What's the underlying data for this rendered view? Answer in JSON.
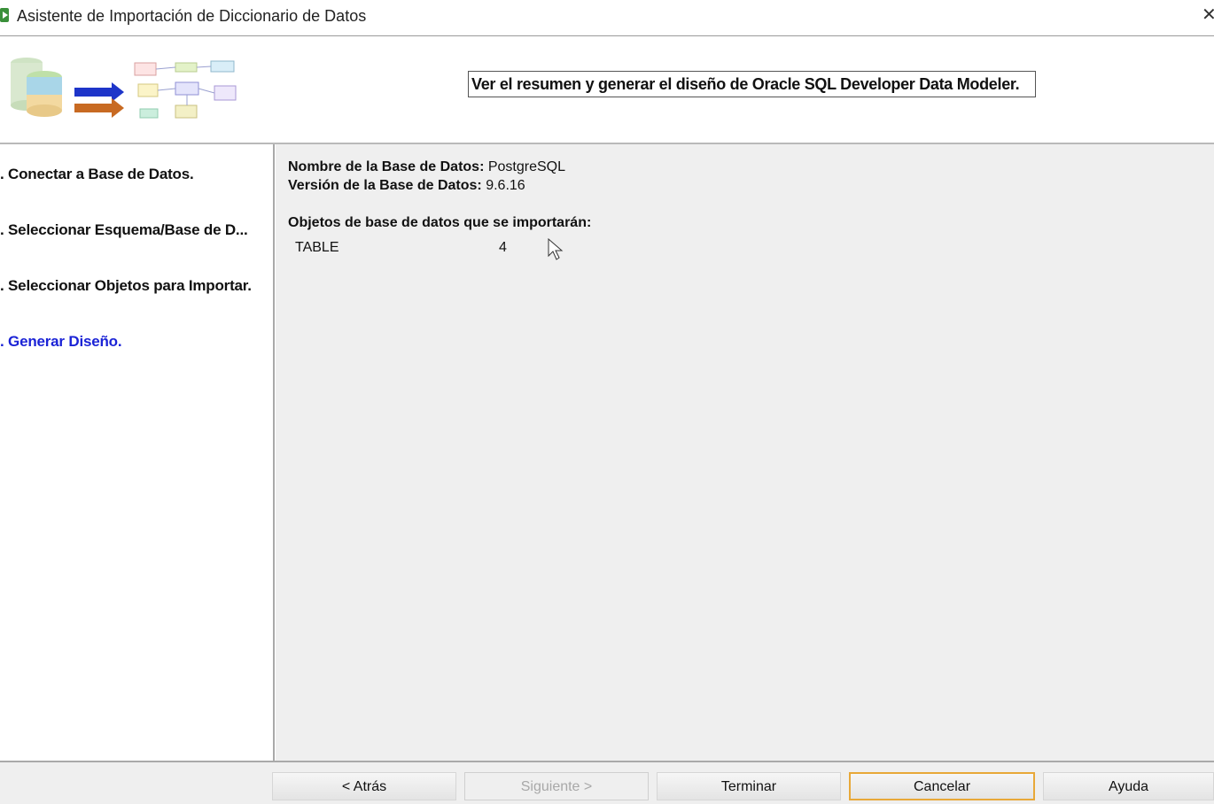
{
  "window": {
    "title": "Asistente de Importación de Diccionario de Datos",
    "close_glyph": "✕"
  },
  "header": {
    "caption": "Ver el resumen y generar el diseño de Oracle SQL Developer Data Modeler."
  },
  "steps": [
    {
      "label": ". Conectar a Base de Datos.",
      "active": false
    },
    {
      "label": ". Seleccionar Esquema/Base de D...",
      "active": false
    },
    {
      "label": ". Seleccionar Objetos para Importar.",
      "active": false
    },
    {
      "label": ". Generar Diseño.",
      "active": true
    }
  ],
  "summary": {
    "db_name_label": "Nombre de la Base de Datos:",
    "db_name_value": "PostgreSQL",
    "db_version_label": "Versión de la Base de Datos:",
    "db_version_value": "9.6.16",
    "objects_heading": "Objetos de base de datos que se importarán:",
    "objects": [
      {
        "type": "TABLE",
        "count": "4"
      }
    ]
  },
  "buttons": {
    "back": "< Atrás",
    "next": "Siguiente >",
    "finish": "Terminar",
    "cancel": "Cancelar",
    "help": "Ayuda"
  },
  "colors": {
    "active_step": "#1b23d6",
    "focus_border": "#e8a838"
  },
  "icons": {
    "title": "app-wizard-icon",
    "graphic": "database-to-model-graphic",
    "close": "close-icon",
    "cursor": "mouse-cursor-icon"
  }
}
